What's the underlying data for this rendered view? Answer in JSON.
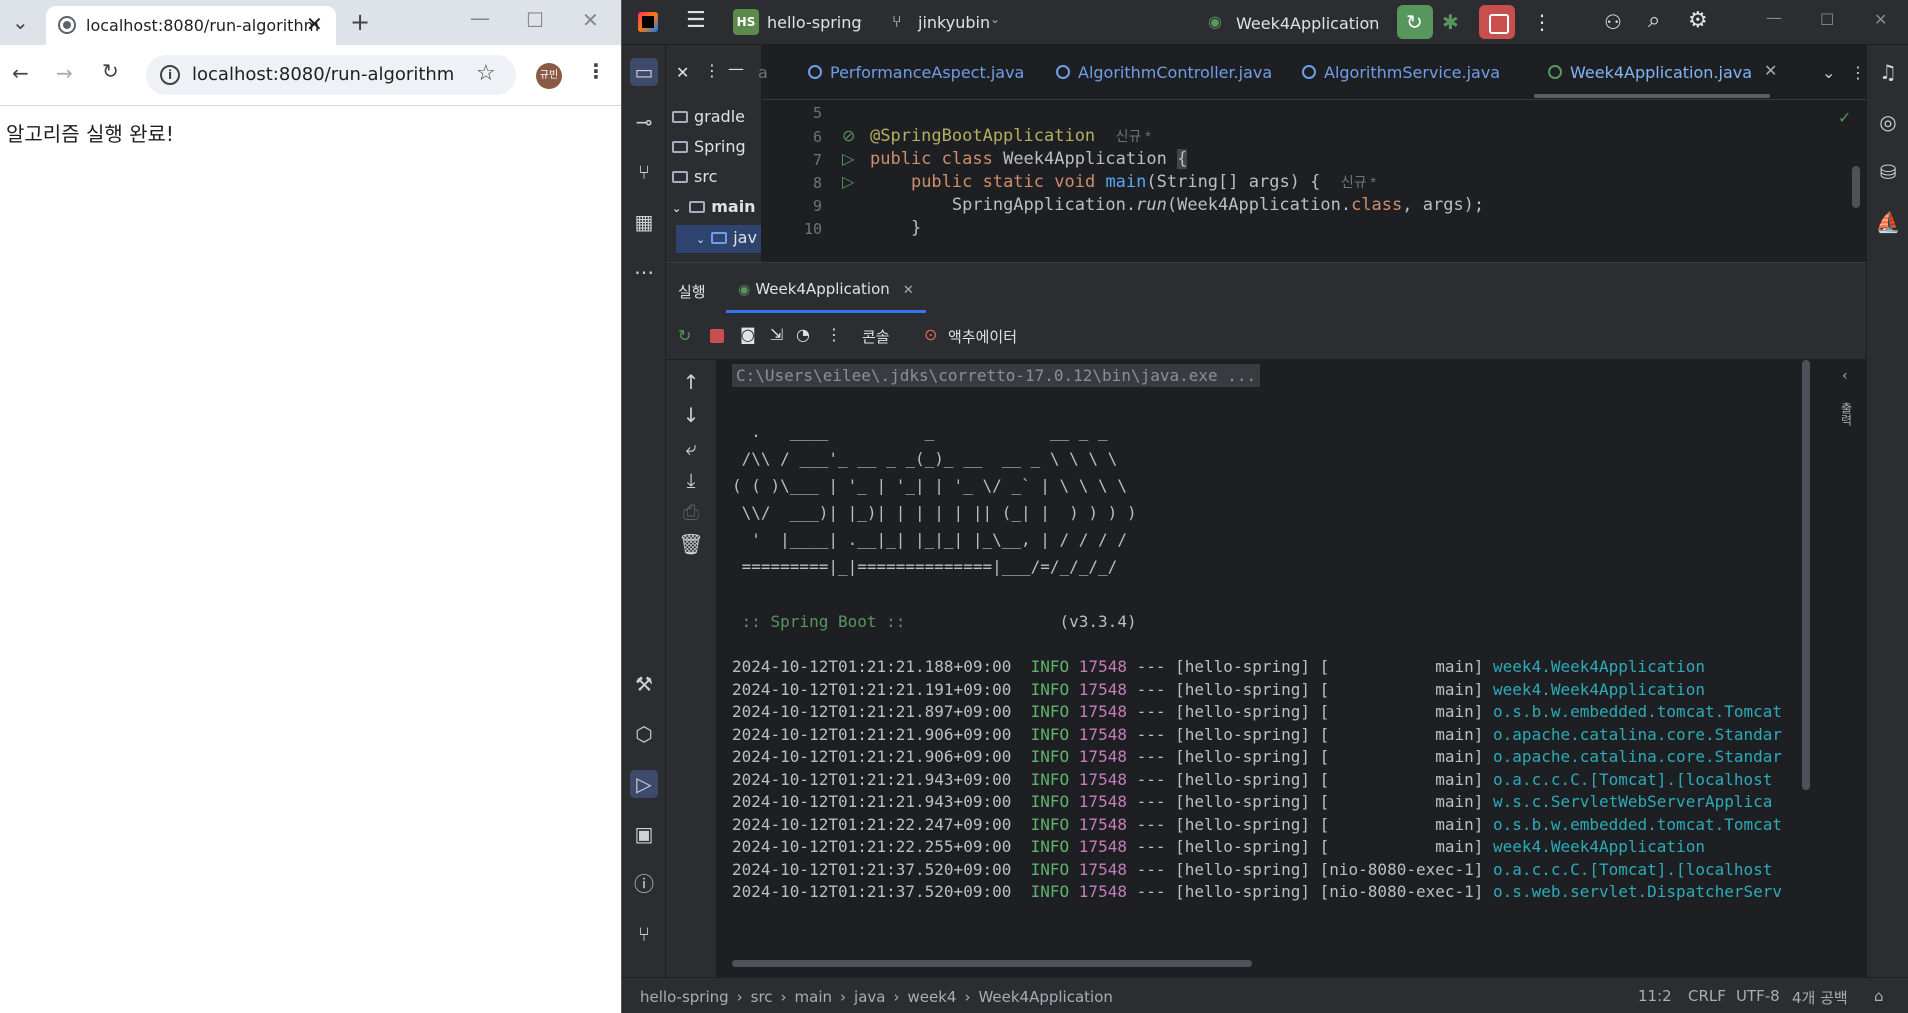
{
  "browser": {
    "tab_title": "localhost:8080/run-algorithm",
    "url": "localhost:8080/run-algorithm",
    "avatar_label": "규빈",
    "page_text": "알고리즘 실행 완료!"
  },
  "ide": {
    "project_badge": "HS",
    "project_name": "hello-spring",
    "vcs_user": "jinkyubin",
    "run_config": "Week4Application",
    "project_tree": [
      "gradle",
      "Spring",
      "src",
      "main",
      "jav"
    ],
    "editor_tabs": [
      {
        "label": "a"
      },
      {
        "label": "PerformanceAspect.java"
      },
      {
        "label": "AlgorithmController.java"
      },
      {
        "label": "AlgorithmService.java"
      },
      {
        "label": "Week4Application.java"
      }
    ],
    "code": {
      "line_numbers": [
        "5",
        "6",
        "7",
        "8",
        "9",
        "10"
      ],
      "l6_annotation": "@SpringBootApplication",
      "l6_hint": "신규 *",
      "l7_kw": "public class",
      "l7_name": "Week4Application",
      "l7_brace": "{",
      "l8_kw": "public static void",
      "l8_fn": "main",
      "l8_args": "(String[] args) {",
      "l8_hint": "신규 *",
      "l9_pre": "SpringApplication.",
      "l9_run": "run",
      "l9_open": "(Week4Application.",
      "l9_class": "class",
      "l9_rest": ", args);",
      "l10": "}"
    },
    "run_panel": {
      "label": "실행",
      "tab": "Week4Application",
      "console_tab": "콘솔",
      "actuator_tab": "액추에이터"
    },
    "console": {
      "cmd": "C:\\Users\\eilee\\.jdks\\corretto-17.0.12\\bin\\java.exe ...",
      "banner": [
        "  .   ____          _            __ _ _",
        " /\\\\ / ___'_ __ _ _(_)_ __  __ _ \\ \\ \\ \\",
        "( ( )\\___ | '_ | '_| | '_ \\/ _` | \\ \\ \\ \\",
        " \\\\/  ___)| |_)| | | | | || (_| |  ) ) ) )",
        "  '  |____| .__|_| |_|_| |_\\__, | / / / /",
        " =========|_|==============|___/=/_/_/_/"
      ],
      "boot_label": " :: Spring Boot ::",
      "boot_version": "(v3.3.4)",
      "logs": [
        {
          "ts": "2024-10-12T01:21:21.188+09:00",
          "level": "INFO",
          "pid": "17548",
          "app": "--- [hello-spring] [           main]",
          "logger": "week4.Week4Application"
        },
        {
          "ts": "2024-10-12T01:21:21.191+09:00",
          "level": "INFO",
          "pid": "17548",
          "app": "--- [hello-spring] [           main]",
          "logger": "week4.Week4Application"
        },
        {
          "ts": "2024-10-12T01:21:21.897+09:00",
          "level": "INFO",
          "pid": "17548",
          "app": "--- [hello-spring] [           main]",
          "logger": "o.s.b.w.embedded.tomcat.Tomcat"
        },
        {
          "ts": "2024-10-12T01:21:21.906+09:00",
          "level": "INFO",
          "pid": "17548",
          "app": "--- [hello-spring] [           main]",
          "logger": "o.apache.catalina.core.Standar"
        },
        {
          "ts": "2024-10-12T01:21:21.906+09:00",
          "level": "INFO",
          "pid": "17548",
          "app": "--- [hello-spring] [           main]",
          "logger": "o.apache.catalina.core.Standar"
        },
        {
          "ts": "2024-10-12T01:21:21.943+09:00",
          "level": "INFO",
          "pid": "17548",
          "app": "--- [hello-spring] [           main]",
          "logger": "o.a.c.c.C.[Tomcat].[localhost"
        },
        {
          "ts": "2024-10-12T01:21:21.943+09:00",
          "level": "INFO",
          "pid": "17548",
          "app": "--- [hello-spring] [           main]",
          "logger": "w.s.c.ServletWebServerApplica"
        },
        {
          "ts": "2024-10-12T01:21:22.247+09:00",
          "level": "INFO",
          "pid": "17548",
          "app": "--- [hello-spring] [           main]",
          "logger": "o.s.b.w.embedded.tomcat.Tomcat"
        },
        {
          "ts": "2024-10-12T01:21:22.255+09:00",
          "level": "INFO",
          "pid": "17548",
          "app": "--- [hello-spring] [           main]",
          "logger": "week4.Week4Application"
        },
        {
          "ts": "2024-10-12T01:21:37.520+09:00",
          "level": "INFO",
          "pid": "17548",
          "app": "--- [hello-spring] [nio-8080-exec-1]",
          "logger": "o.a.c.c.C.[Tomcat].[localhost"
        },
        {
          "ts": "2024-10-12T01:21:37.520+09:00",
          "level": "INFO",
          "pid": "17548",
          "app": "--- [hello-spring] [nio-8080-exec-1]",
          "logger": "o.s.web.servlet.DispatcherServ"
        }
      ],
      "side_label": "출력"
    },
    "status": {
      "breadcrumb": [
        "hello-spring",
        "src",
        "main",
        "java",
        "week4",
        "Week4Application"
      ],
      "position": "11:2",
      "line_sep": "CRLF",
      "encoding": "UTF-8",
      "indent": "4개 공백"
    }
  }
}
